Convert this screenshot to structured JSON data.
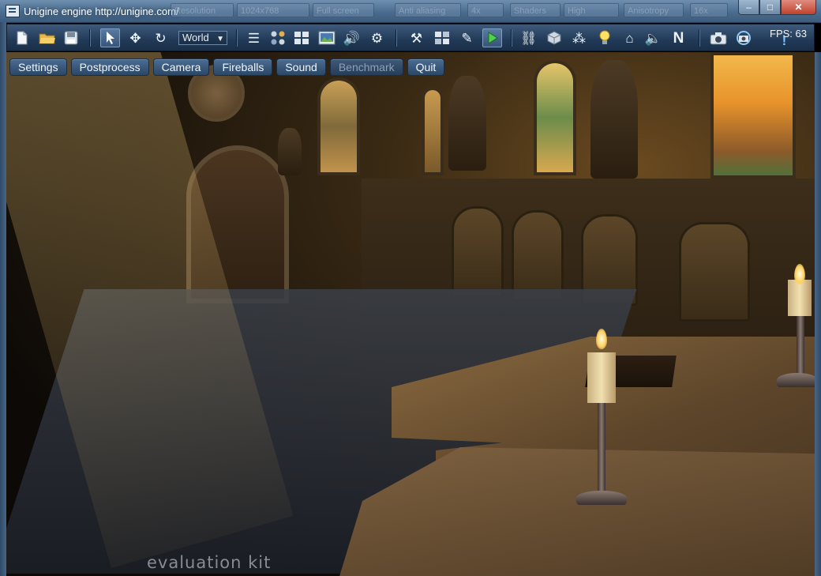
{
  "window": {
    "title": "Unigine engine http://unigine.com/",
    "controls": {
      "minimize": "–",
      "maximize": "□",
      "close": "✕"
    },
    "background_menu_ghost": [
      "Resolution",
      "1024x768",
      "Full screen",
      "Anti aliasing",
      "4x",
      "Shaders",
      "High",
      "Anisotropy",
      "16x"
    ]
  },
  "toolbar": {
    "world_select": "World",
    "fps": "FPS: 63",
    "icons": [
      "new-file-icon",
      "open-folder-icon",
      "save-icon",
      "select-arrow-icon",
      "move-icon",
      "rotate-icon",
      "world-dropdown",
      "tree-list-icon",
      "materials-icon",
      "grid-icon",
      "image-icon",
      "sound-icon",
      "gears-icon",
      "tools-icon",
      "windows-icon",
      "edit-icon",
      "play-icon",
      "link-icon",
      "box-icon",
      "particles-icon",
      "light-bulb-icon",
      "cube-scene-icon",
      "speaker-icon",
      "n-logo-icon",
      "camera-icon",
      "camera-rotate-icon",
      "info-icon"
    ]
  },
  "menu": {
    "items": [
      {
        "label": "Settings",
        "enabled": true
      },
      {
        "label": "Postprocess",
        "enabled": true
      },
      {
        "label": "Camera",
        "enabled": true
      },
      {
        "label": "Fireballs",
        "enabled": true
      },
      {
        "label": "Sound",
        "enabled": true
      },
      {
        "label": "Benchmark",
        "enabled": false
      },
      {
        "label": "Quit",
        "enabled": true
      }
    ]
  },
  "scene": {
    "watermark": "evaluation kit"
  },
  "colors": {
    "titlebar": "#4a6c8e",
    "toolbar": "#213a57",
    "menu_button": "#2a4766",
    "close_button": "#c0422c"
  }
}
